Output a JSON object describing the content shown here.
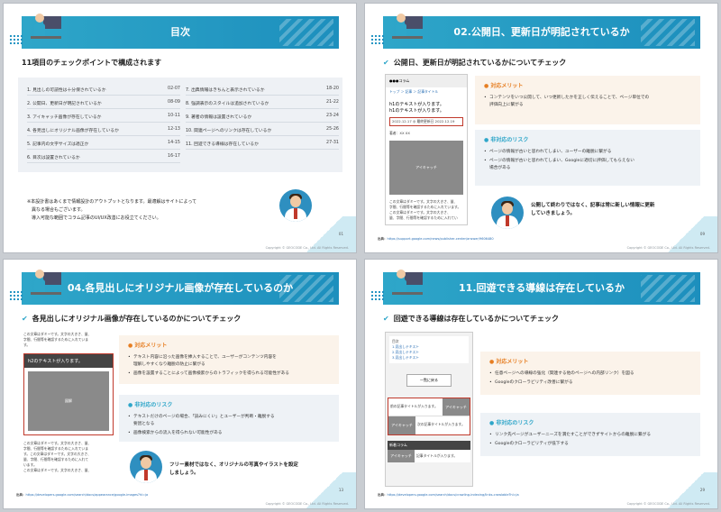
{
  "footer": "Copyright © GEOCODE Co., Ltd. All Rights Reserved.",
  "slide1": {
    "title": "目次",
    "heading": "11項目のチェックポイントで構成されます",
    "items_left": [
      {
        "label": "1. 見出しの可読性は十分保されているか",
        "page": "02-07"
      },
      {
        "label": "2. 公開日、更新日が明記されているか",
        "page": "08-09"
      },
      {
        "label": "3. アイキャッチ画像が存在しているか",
        "page": "10-11"
      },
      {
        "label": "4. 各見出しにオリジナル画像が存在しているか",
        "page": "12-13"
      },
      {
        "label": "5. 記事内の文字サイズは適正か",
        "page": "14-15"
      },
      {
        "label": "6. 目次は設置されているか",
        "page": "16-17"
      }
    ],
    "items_right": [
      {
        "label": "7. 出典情報はきちんと表示されているか",
        "page": "18-20"
      },
      {
        "label": "8. 強調表示のスタイルは追加されているか",
        "page": "21-22"
      },
      {
        "label": "9. 著者の情報は設置されているか",
        "page": "23-24"
      },
      {
        "label": "10. 関連ページへのリンクは存在しているか",
        "page": "25-26"
      },
      {
        "label": "11. 回遊できる導線は存在しているか",
        "page": "27-31"
      }
    ],
    "note": [
      "※本設計書はあくまで情報設計のアウトプットとなります。最適解はサイトによって",
      "　異なる場合もございます。",
      "　導入可能な範囲でコラム記事のUI/UX改善にお役立てください。"
    ],
    "page": "01"
  },
  "slide2": {
    "title": "02.公開日、更新日が明記されているか",
    "heading": "公開日、更新日が明記されているかについてチェック",
    "mock": {
      "logo": "●●●コラム",
      "breadcrumb": "トップ ＞ 記事 ＞ 記事タイトル",
      "h1": [
        "h1のテキストが入ります。",
        "h1のテキストが入ります。"
      ],
      "date": "2022.12.17 ◎ 最終更新日 2022.12.19",
      "author": "著者：XX XX",
      "eyecatch": "アイキャッチ",
      "body": [
        "この文章はダミーです。文字の大きさ、量、",
        "字間、行間等を確認するために入れています。",
        "この文章はダミーです。文字の大きさ、",
        "量、字間、行間等を確認するために入れてい"
      ]
    },
    "merit": {
      "title": "対応メリット",
      "items": [
        "コンテンツをいつ公開して、いつ更新したかを正しく伝えることで、ページ単位での",
        "評価向上に繋がる"
      ]
    },
    "risk": {
      "title": "非対応のリスク",
      "items": [
        "ページの情報が古いと思われてしまい、ユーザーの離脱に繋がる",
        "ページの情報が古いと思われてしまい、Googleに適切に評価してもらえない",
        "場合がある"
      ]
    },
    "message": [
      "公開して終わりではなく、記事は常に新しい情報に更新",
      "していきましょう。"
    ],
    "source_label": "出典：",
    "source": "https://support.google.com/news/publisher-center/answer/9606480",
    "page": "09"
  },
  "slide3": {
    "title": "04.各見出しにオリジナル画像が存在しているのか",
    "heading": "各見出しにオリジナル画像が存在しているのかについてチェック",
    "mock": {
      "top": [
        "この文章はダミーです。文字の大きさ、量、",
        "字間、行間等を確認するために入れていま",
        "す。"
      ],
      "h2": "h2のテキストが入ります。",
      "image": "図解",
      "bottom": [
        "この文章はダミーです。文字の大きさ、量、",
        "字間、行間等を確認するために入れていま",
        "す。この文章はダミーです。文字の大きさ、",
        "量、字間、行間等を確認するために入れて",
        "います。",
        "この文章はダミーです。文字の大きさ、量、"
      ]
    },
    "merit": {
      "title": "対応メリット",
      "items": [
        "テキスト内容に沿った画像を挿入することで、ユーザーがコンテンツ内容を",
        "理解しやすくなり離脱の防止に繋がる",
        "画像を設置することによって画像検索からのトラフィックを得られる可能性がある"
      ]
    },
    "risk": {
      "title": "非対応のリスク",
      "items": [
        "テキストだけのページの場合、「読みにくい」とユーザーが判断・離脱する",
        "要因となる",
        "画像検索からの流入を得られない可能性がある"
      ]
    },
    "message": [
      "フリー素材ではなく、オリジナルの写真やイラストを設定",
      "しましょう。"
    ],
    "source_label": "出典：",
    "source": "https://developers.google.com/search/docs/appearance/google-images?hl=ja",
    "page": "13"
  },
  "slide4": {
    "title": "11.回遊できる導線は存在しているか",
    "heading": "回遊できる導線は存在しているかについてチェック",
    "mock": {
      "toc_title": "目次",
      "toc": [
        "1.見出しテキスト",
        "2.見出しテキスト",
        "3.見出しテキスト"
      ],
      "button": "一覧に戻る",
      "prev": "前の記事タイトルが入ります。",
      "eyecatch": "アイキャッチ",
      "next": "次の記事タイトルが入ります。",
      "new_label": "新着コラム",
      "new_item": "記事タイトルが入ります。"
    },
    "merit": {
      "title": "対応メリット",
      "items": [
        "任意ページへの導線の強化（関連する他のページへの内部リンク）を図る",
        "Googleのクローラビリティ改善に繋がる"
      ]
    },
    "risk": {
      "title": "非対応のリスク",
      "items": [
        "リンク先ページがユーザーニーズを満たすことができずサイトからの離脱に繋がる",
        "Googleのクローラビリティが低下する"
      ]
    },
    "source_label": "出典：",
    "source": "https://developers.google.com/search/docs/crawling-indexing/links-crawlable?hl=ja",
    "page": "29"
  }
}
